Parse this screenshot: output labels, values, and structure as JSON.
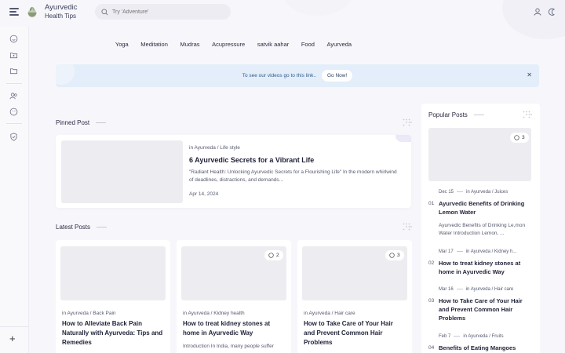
{
  "header": {
    "brand_line1": "Ayurvedic",
    "brand_line2": "Health Tips",
    "search_placeholder": "Try 'Adventure'"
  },
  "nav": [
    "Yoga",
    "Meditation",
    "Mudras",
    "Acupressure",
    "satvik aahar",
    "Food",
    "Ayurveda"
  ],
  "banner": {
    "text": "To see our videos go to this link..",
    "button": "Go Now!",
    "close": "✕"
  },
  "sidebar": {
    "plus": "+"
  },
  "pinned": {
    "section_title": "Pinned Post",
    "meta": "in Ayurveda / Life style",
    "title": "6 Ayurvedic Secrets for a Vibrant Life",
    "excerpt": "\"Radiant Health: Unlocking Ayurvedic Secrets for a Flourishing Life\" In the modern whirlwind of deadlines, distractions, and demands...",
    "date": "Apr 14, 2024"
  },
  "latest": {
    "section_title": "Latest Posts",
    "cards": [
      {
        "meta": "in Ayurveda / Back Pain",
        "title": "How to Alleviate Back Pain Naturally with Ayurveda: Tips and Remedies",
        "excerpt": "",
        "comments": ""
      },
      {
        "meta": "in Ayurveda / Kidney health",
        "title": "How to treat kidney stones at home in Ayurvedic Way",
        "excerpt": "Introduction In India, many people suffer",
        "comments": "2"
      },
      {
        "meta": "in Ayurveda / Hair care",
        "title": "How to Take Care of Your Hair and Prevent Common Hair Problems",
        "excerpt": "",
        "comments": "3"
      }
    ]
  },
  "popular": {
    "section_title": "Popular Posts",
    "comments": "3",
    "items": [
      {
        "num": "01",
        "date": "Dec 15",
        "category": "in Ayurveda / Juices",
        "title": "Ayurvedic Benefits of Drinking Lemon Water",
        "excerpt": "Ayurvedic Benefits of Drinking Le,mon Water Introduction Lemon, ..."
      },
      {
        "num": "02",
        "date": "Mar 17",
        "category": "in Ayurveda / Kidney h...",
        "title": "How to treat kidney stones at home in Ayurvedic Way",
        "excerpt": ""
      },
      {
        "num": "03",
        "date": "Mar 16",
        "category": "in Ayurveda / Hair care",
        "title": "How to Take Care of Your Hair and Prevent Common Hair Problems",
        "excerpt": ""
      },
      {
        "num": "04",
        "date": "Feb 7",
        "category": "in Ayurveda / Fruits",
        "title": "Benefits of Eating Mangoes",
        "excerpt": ""
      }
    ]
  },
  "colors": {
    "banner_bg": "#e3eefa",
    "banner_text": "#2f5c8e",
    "accent": "#ebe8f8"
  }
}
